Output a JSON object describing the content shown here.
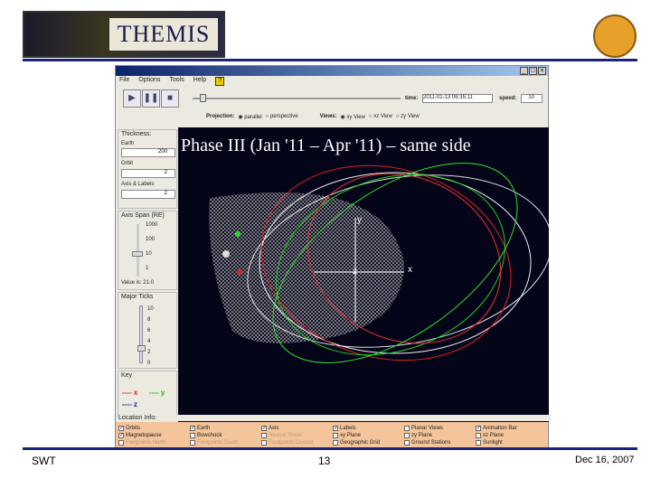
{
  "slide": {
    "logo_text": "THEMIS",
    "footer_left": "SWT",
    "page_number": "13",
    "date": "Dec 16, 2007",
    "overlay_title": "Phase III (Jan '11 – Apr '11) – same side"
  },
  "app": {
    "menu": [
      "File",
      "Options",
      "Tools",
      "Help"
    ],
    "time_label": "time:",
    "time_value": "2011-01-13 06:35:11",
    "speed_label": "speed:",
    "speed_value": "10",
    "projection_label": "Projection:",
    "projection_options": [
      "parallel",
      "perspective"
    ],
    "projection_selected": "parallel",
    "views_label": "Views:",
    "views_options": [
      "xy View",
      "xz View",
      "zy View"
    ],
    "views_selected": "xy View",
    "thickness_label": "Thickness:",
    "thickness_fields": [
      {
        "label": "Earth",
        "value": "200"
      },
      {
        "label": "Orbit",
        "value": "2"
      },
      {
        "label": "Axis & Labels",
        "value": "2"
      }
    ],
    "axis_span_label": "Axis Span (RE)",
    "axis_span_ticks": [
      "1000",
      "100",
      "10",
      "1"
    ],
    "axis_span_value_text": "Value is: 21.0",
    "major_ticks_label": "Major Ticks",
    "major_ticks": [
      "10",
      "8",
      "6",
      "4",
      "2",
      "0"
    ],
    "major_ticks_value": 2,
    "key_label": "Key",
    "key": [
      {
        "label": "x",
        "color": "#e02020"
      },
      {
        "label": "y",
        "color": "#20b020"
      },
      {
        "label": "z",
        "color": "#2020a0"
      }
    ],
    "axis_labels": {
      "x": "x",
      "y": "y",
      "z": "z"
    },
    "location_info_label": "Location Info:",
    "checkboxes": [
      [
        {
          "label": "Orbits",
          "checked": true
        },
        {
          "label": "Magnetopause",
          "checked": true
        },
        {
          "label": "Footpoints North",
          "checked": false,
          "disabled": true
        }
      ],
      [
        {
          "label": "Earth",
          "checked": true
        },
        {
          "label": "Bowshock",
          "checked": false
        },
        {
          "label": "Footpoints South",
          "checked": false,
          "disabled": true
        }
      ],
      [
        {
          "label": "Axis",
          "checked": true
        },
        {
          "label": "Neutral Sheet",
          "checked": false,
          "disabled": true
        },
        {
          "label": "Footpoints Closest",
          "checked": false,
          "disabled": true
        }
      ],
      [
        {
          "label": "Labels",
          "checked": true
        },
        {
          "label": "xy Plane",
          "checked": false
        },
        {
          "label": "Geographic Grid",
          "checked": false
        }
      ],
      [
        {
          "label": "Planar Views",
          "checked": false
        },
        {
          "label": "zy Plane",
          "checked": false
        },
        {
          "label": "Ground Stations",
          "checked": false
        }
      ],
      [
        {
          "label": "Animation Bar",
          "checked": true
        },
        {
          "label": "xz Plane",
          "checked": false
        },
        {
          "label": "Sunlight",
          "checked": false
        }
      ]
    ]
  }
}
